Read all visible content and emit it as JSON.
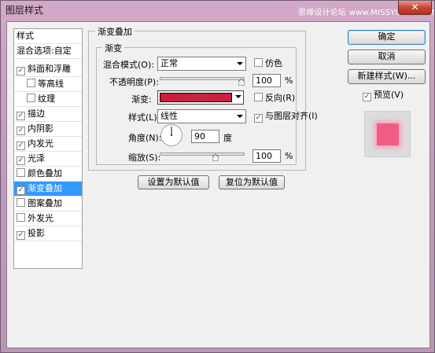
{
  "window": {
    "title": "图层样式",
    "watermark": "思缘设计论坛 www.MISSYUAN.COM",
    "close_glyph": "✕"
  },
  "left_panel": {
    "items": [
      {
        "label": "样式",
        "type": "header"
      },
      {
        "label": "混合选项:自定",
        "type": "header"
      },
      {
        "label": "斜面和浮雕",
        "checked": true,
        "indent": false,
        "selected": false
      },
      {
        "label": "等高线",
        "checked": false,
        "indent": true,
        "selected": false
      },
      {
        "label": "纹理",
        "checked": false,
        "indent": true,
        "selected": false
      },
      {
        "label": "描边",
        "checked": true,
        "indent": false,
        "selected": false
      },
      {
        "label": "内阴影",
        "checked": true,
        "indent": false,
        "selected": false
      },
      {
        "label": "内发光",
        "checked": true,
        "indent": false,
        "selected": false
      },
      {
        "label": "光泽",
        "checked": true,
        "indent": false,
        "selected": false
      },
      {
        "label": "颜色叠加",
        "checked": false,
        "indent": false,
        "selected": false
      },
      {
        "label": "渐变叠加",
        "checked": true,
        "indent": false,
        "selected": true
      },
      {
        "label": "图案叠加",
        "checked": false,
        "indent": false,
        "selected": false
      },
      {
        "label": "外发光",
        "checked": false,
        "indent": false,
        "selected": false
      },
      {
        "label": "投影",
        "checked": true,
        "indent": false,
        "selected": false
      }
    ]
  },
  "gradient_overlay": {
    "section_title": "渐变叠加",
    "group_title": "渐变",
    "blend_mode_label": "混合模式(O):",
    "blend_mode_value": "正常",
    "dither_label": "仿色",
    "dither_checked": false,
    "opacity_label": "不透明度(P):",
    "opacity_value": "100",
    "opacity_unit": "%",
    "opacity_level": 1.0,
    "gradient_label": "渐变:",
    "reverse_label": "反向(R)",
    "reverse_checked": false,
    "style_label": "样式(L):",
    "style_value": "线性",
    "align_label": "与图层对齐(I)",
    "align_checked": true,
    "angle_label": "角度(N):",
    "angle_value": "90",
    "angle_unit": "度",
    "scale_label": "缩放(S):",
    "scale_value": "100",
    "scale_unit": "%",
    "scale_level": 0.6667,
    "set_default_label": "设置为默认值",
    "reset_default_label": "复位为默认值"
  },
  "buttons": {
    "ok_label": "确定",
    "cancel_label": "取消",
    "new_style_label": "新建样式(W)...",
    "preview_label": "预览(V)",
    "preview_checked": true
  },
  "colors": {
    "selection": "#3399ff",
    "gradient_start": "#d11a3a",
    "gradient_end": "#d31a3d",
    "preview_fill": "#f25c84"
  }
}
